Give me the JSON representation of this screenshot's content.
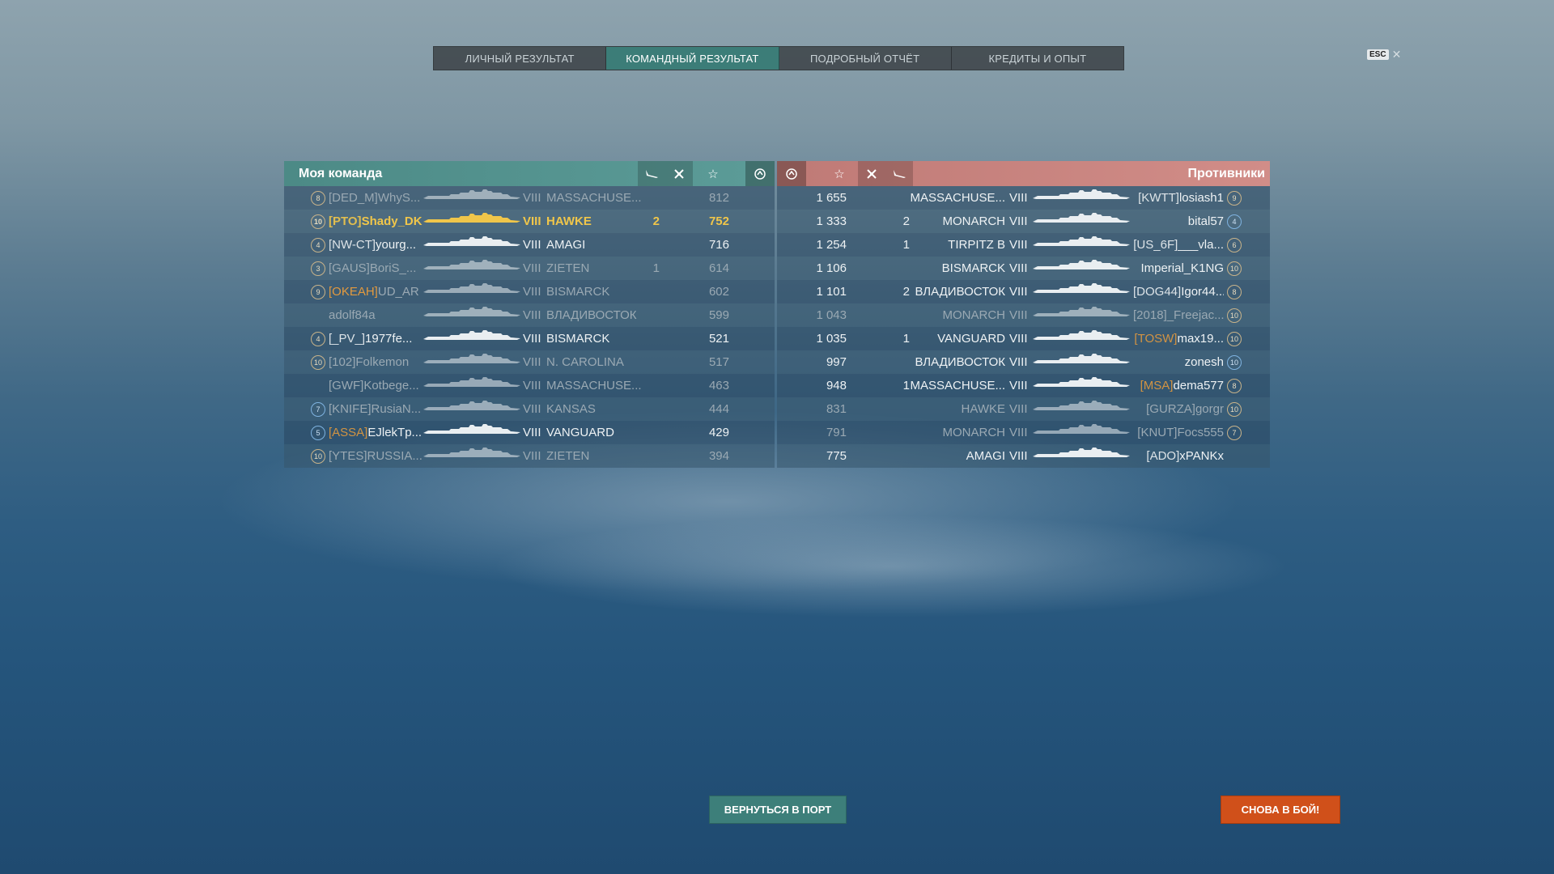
{
  "tabs": [
    {
      "label": "ЛИЧНЫЙ РЕЗУЛЬТАТ",
      "active": false
    },
    {
      "label": "КОМАНДНЫЙ РЕЗУЛЬТАТ",
      "active": true
    },
    {
      "label": "ПОДРОБНЫЙ ОТЧЁТ",
      "active": false
    },
    {
      "label": "КРЕДИТЫ И ОПЫТ",
      "active": false
    }
  ],
  "esc": {
    "key": "ESC",
    "close": "✕"
  },
  "my_team": {
    "title": "Моя команда",
    "header_icons": [
      "ship-kills-icon",
      "plane-kills-icon",
      "star-icon",
      "base-icon"
    ],
    "rows": [
      {
        "rank": "8",
        "clan": "[DED_M]",
        "name": "WhyS...",
        "tier": "VIII",
        "ship": "MASSACHUSE...",
        "kills": "",
        "score": "812",
        "state": "dead"
      },
      {
        "rank": "10",
        "clan": "[PTO]",
        "name": "Shady_DK",
        "tier": "VIII",
        "ship": "HAWKE",
        "kills": "2",
        "score": "752",
        "state": "me"
      },
      {
        "rank": "4",
        "clan": "[NW-CT]",
        "name": "yourg...",
        "tier": "VIII",
        "ship": "AMAGI",
        "kills": "",
        "score": "716",
        "state": "alive"
      },
      {
        "rank": "3",
        "clan": "[GAUS]",
        "name": "BoriS_...",
        "tier": "VIII",
        "ship": "ZIETEN",
        "kills": "1",
        "score": "614",
        "state": "dead"
      },
      {
        "rank": "9",
        "clan": "[OKEAH]",
        "name": "UD_AR",
        "tier": "VIII",
        "ship": "BISMARCK",
        "kills": "",
        "score": "602",
        "state": "dead",
        "clan_color": "orange"
      },
      {
        "rank": "",
        "clan": "",
        "name": "adolf84a",
        "tier": "VIII",
        "ship": "ВЛАДИВОСТОК",
        "kills": "",
        "score": "599",
        "state": "dead"
      },
      {
        "rank": "4",
        "clan": "[_PV_]",
        "name": "1977fe...",
        "tier": "VIII",
        "ship": "BISMARCK",
        "kills": "",
        "score": "521",
        "state": "alive"
      },
      {
        "rank": "10",
        "clan": "[102]",
        "name": "Folkemon",
        "tier": "VIII",
        "ship": "N. CAROLINA",
        "kills": "",
        "score": "517",
        "state": "dead"
      },
      {
        "rank": "",
        "clan": "[GWF]",
        "name": "Kotbege...",
        "tier": "VIII",
        "ship": "MASSACHUSE...",
        "kills": "",
        "score": "463",
        "state": "dead"
      },
      {
        "rank": "7",
        "clan": "[KNIFE]",
        "name": "RusiaN...",
        "tier": "VIII",
        "ship": "KANSAS",
        "kills": "",
        "score": "444",
        "state": "dead",
        "rank_color": "blue"
      },
      {
        "rank": "5",
        "clan": "[ASSA]",
        "name": "EJlekTp...",
        "tier": "VIII",
        "ship": "VANGUARD",
        "kills": "",
        "score": "429",
        "state": "alive",
        "clan_color": "orange",
        "rank_color": "blue"
      },
      {
        "rank": "10",
        "clan": "[YTES]",
        "name": "RUSSIA...",
        "tier": "VIII",
        "ship": "ZIETEN",
        "kills": "",
        "score": "394",
        "state": "dead"
      }
    ]
  },
  "enemies": {
    "title": "Противники",
    "header_icons": [
      "base-icon",
      "star-icon",
      "plane-kills-icon",
      "ship-kills-icon"
    ],
    "rows": [
      {
        "score": "1 655",
        "kills": "",
        "ship": "MASSACHUSE...",
        "tier": "VIII",
        "clan": "[KWTT]",
        "name": "losiash1",
        "rank": "9",
        "state": "alive"
      },
      {
        "score": "1 333",
        "kills": "2",
        "ship": "MONARCH",
        "tier": "VIII",
        "clan": "",
        "name": "bital57",
        "rank": "4",
        "state": "alive",
        "rank_color": "blue"
      },
      {
        "score": "1 254",
        "kills": "1",
        "ship": "TIRPITZ B",
        "tier": "VIII",
        "clan": "[US_6F]",
        "name": "___vla...",
        "rank": "6",
        "state": "alive"
      },
      {
        "score": "1 106",
        "kills": "",
        "ship": "BISMARCK",
        "tier": "VIII",
        "clan": "",
        "name": "Imperial_K1NG",
        "rank": "10",
        "state": "alive"
      },
      {
        "score": "1 101",
        "kills": "2",
        "ship": "ВЛАДИВОСТОК",
        "tier": "VIII",
        "clan": "[DOG44]",
        "name": "Igor44...",
        "rank": "8",
        "state": "alive"
      },
      {
        "score": "1 043",
        "kills": "",
        "ship": "MONARCH",
        "tier": "VIII",
        "clan": "[2018]",
        "name": "_Freejac...",
        "rank": "10",
        "state": "dead"
      },
      {
        "score": "1 035",
        "kills": "1",
        "ship": "VANGUARD",
        "tier": "VIII",
        "clan": "[TOSW]",
        "name": "max19...",
        "rank": "10",
        "state": "alive",
        "clan_color": "orange"
      },
      {
        "score": "997",
        "kills": "",
        "ship": "ВЛАДИВОСТОК",
        "tier": "VIII",
        "clan": "",
        "name": "zonesh",
        "rank": "10",
        "state": "alive",
        "rank_color": "blue"
      },
      {
        "score": "948",
        "kills": "1",
        "ship": "MASSACHUSE...",
        "tier": "VIII",
        "clan": "[MSA]",
        "name": "dema577",
        "rank": "8",
        "state": "alive",
        "clan_color": "orange"
      },
      {
        "score": "831",
        "kills": "",
        "ship": "HAWKE",
        "tier": "VIII",
        "clan": "[GURZA]",
        "name": "gorgr",
        "rank": "10",
        "state": "dead"
      },
      {
        "score": "791",
        "kills": "",
        "ship": "MONARCH",
        "tier": "VIII",
        "clan": "[KNUT]",
        "name": "Focs555",
        "rank": "7",
        "state": "dead"
      },
      {
        "score": "775",
        "kills": "",
        "ship": "AMAGI",
        "tier": "VIII",
        "clan": "[ADO]",
        "name": "xPANKx",
        "rank": "",
        "state": "alive"
      }
    ]
  },
  "buttons": {
    "port": "ВЕРНУТЬСЯ В ПОРТ",
    "again": "СНОВА В БОЙ!"
  }
}
